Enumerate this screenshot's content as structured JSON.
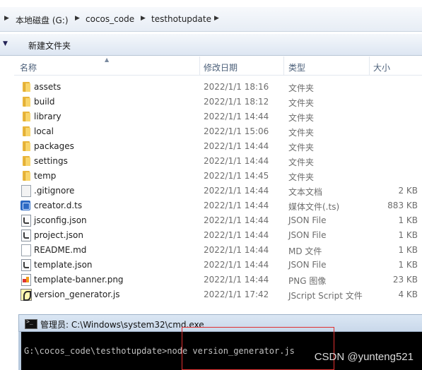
{
  "breadcrumb": {
    "items": [
      "本地磁盘 (G:)",
      "cocos_code",
      "testhotupdate"
    ]
  },
  "toolbar": {
    "new_folder_label": "新建文件夹"
  },
  "columns": {
    "name": "名称",
    "date": "修改日期",
    "type": "类型",
    "size": "大小"
  },
  "files": [
    {
      "name": "assets",
      "date": "2022/1/1 18:16",
      "type": "文件夹",
      "size": "",
      "icon": "folder-icon"
    },
    {
      "name": "build",
      "date": "2022/1/1 18:12",
      "type": "文件夹",
      "size": "",
      "icon": "folder-icon"
    },
    {
      "name": "library",
      "date": "2022/1/1 14:44",
      "type": "文件夹",
      "size": "",
      "icon": "folder-icon"
    },
    {
      "name": "local",
      "date": "2022/1/1 15:06",
      "type": "文件夹",
      "size": "",
      "icon": "folder-icon"
    },
    {
      "name": "packages",
      "date": "2022/1/1 14:44",
      "type": "文件夹",
      "size": "",
      "icon": "folder-icon"
    },
    {
      "name": "settings",
      "date": "2022/1/1 14:44",
      "type": "文件夹",
      "size": "",
      "icon": "folder-icon"
    },
    {
      "name": "temp",
      "date": "2022/1/1 14:45",
      "type": "文件夹",
      "size": "",
      "icon": "folder-icon"
    },
    {
      "name": ".gitignore",
      "date": "2022/1/1 14:44",
      "type": "文本文档",
      "size": "2 KB",
      "icon": "text-file-icon"
    },
    {
      "name": "creator.d.ts",
      "date": "2022/1/1 14:44",
      "type": "媒体文件(.ts)",
      "size": "883 KB",
      "icon": "media-file-icon"
    },
    {
      "name": "jsconfig.json",
      "date": "2022/1/1 14:44",
      "type": "JSON File",
      "size": "1 KB",
      "icon": "json-file-icon"
    },
    {
      "name": "project.json",
      "date": "2022/1/1 14:44",
      "type": "JSON File",
      "size": "1 KB",
      "icon": "json-file-icon"
    },
    {
      "name": "README.md",
      "date": "2022/1/1 14:44",
      "type": "MD 文件",
      "size": "1 KB",
      "icon": "blank-file-icon"
    },
    {
      "name": "template.json",
      "date": "2022/1/1 14:44",
      "type": "JSON File",
      "size": "1 KB",
      "icon": "json-file-icon"
    },
    {
      "name": "template-banner.png",
      "date": "2022/1/1 14:44",
      "type": "PNG 图像",
      "size": "23 KB",
      "icon": "image-file-icon"
    },
    {
      "name": "version_generator.js",
      "date": "2022/1/1 17:42",
      "type": "JScript Script 文件",
      "size": "4 KB",
      "icon": "script-file-icon"
    }
  ],
  "cmd": {
    "title": "管理员: C:\\Windows\\system32\\cmd.exe",
    "command_line": "G:\\cocos_code\\testhotupdate>node version_generator.js"
  },
  "watermark": "CSDN @yunteng521"
}
